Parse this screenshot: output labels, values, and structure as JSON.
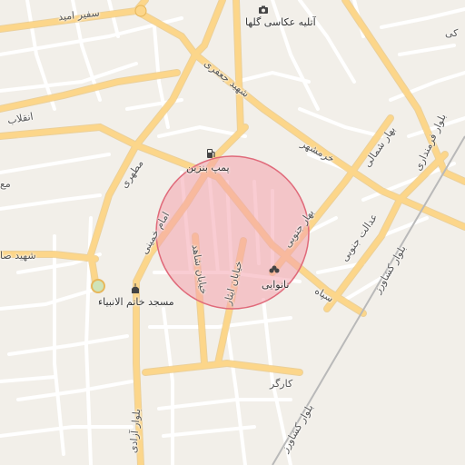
{
  "map": {
    "colors": {
      "background": "#f2efe9",
      "minor_road": "#ffffff",
      "major_road": "#fcd68a",
      "major_road_casing": "#e7b75a",
      "highlight_fill": "#f4a3ad",
      "highlight_stroke": "#e06a7a",
      "railway": "#b9b9b9"
    },
    "labels": {
      "safir_amid": "سفیر امید",
      "atelier": "آتلیه عکاسی گلها",
      "shahid_jafari": "شهید جعفری",
      "enghelab": "انقلاب",
      "pomp_benzin": "پمپ بنزین",
      "motahari": "مطهری",
      "khorramshahr": "خرمشهر",
      "bahar_shomali": "بهار شمالی",
      "bolvar_farmandari": "بلوار فرمنداری",
      "bahar_jonubi": "بهار جنوبی",
      "edalat_jonubi": "عدالت جنوبی",
      "imam_khomeini": "امام خمینی",
      "shahid_sa": "شهید صا",
      "khiaban_shahed": "خیابان شاهد",
      "khiaban_isar": "خیابان ایثار",
      "nanvaei": "نانوایی",
      "sepah": "سپاه",
      "bolvar_keshavarz": "بلوار کشاورز",
      "masjed": "مسجد خاتم الانبیاء",
      "kargar": "کارگر",
      "bolvar_azadi": "بلوار آزادی",
      "bolvar_keshavarz_2": "بلوار کشاورز",
      "edge_ma": "مع",
      "edge_ki": "کی"
    },
    "icons": {
      "camera": "camera-icon",
      "fuel": "fuel-pump-icon",
      "mosque": "mosque-icon",
      "bakery": "bakery-icon"
    }
  }
}
